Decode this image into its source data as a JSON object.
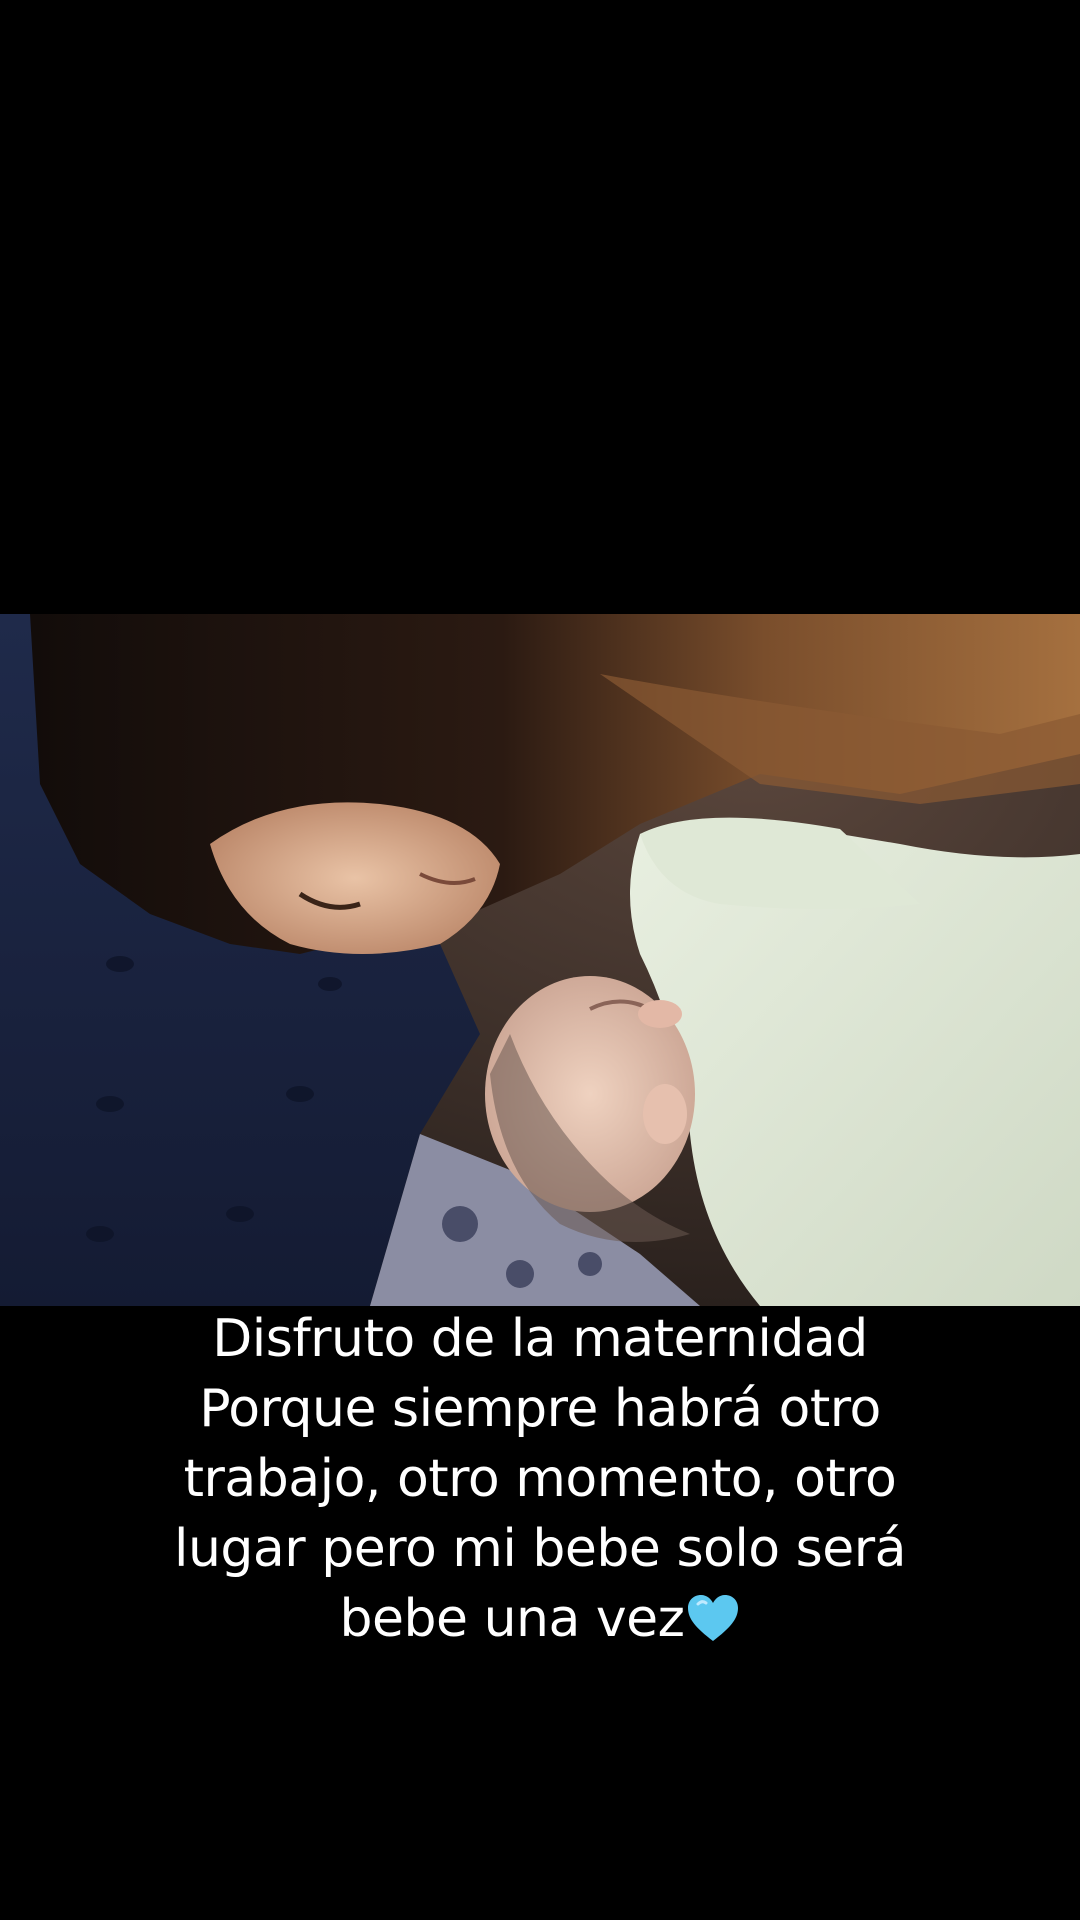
{
  "caption": {
    "lines": [
      "Disfruto de la maternidad",
      "Porque siempre habrá otro",
      "trabajo, otro momento, otro",
      "lugar pero mi bebe solo será",
      "bebe una vez"
    ],
    "emoji": "light-blue-heart-icon"
  },
  "colors": {
    "background": "#000000",
    "caption_text": "#ffffff",
    "heart": "#5cc8f0"
  }
}
